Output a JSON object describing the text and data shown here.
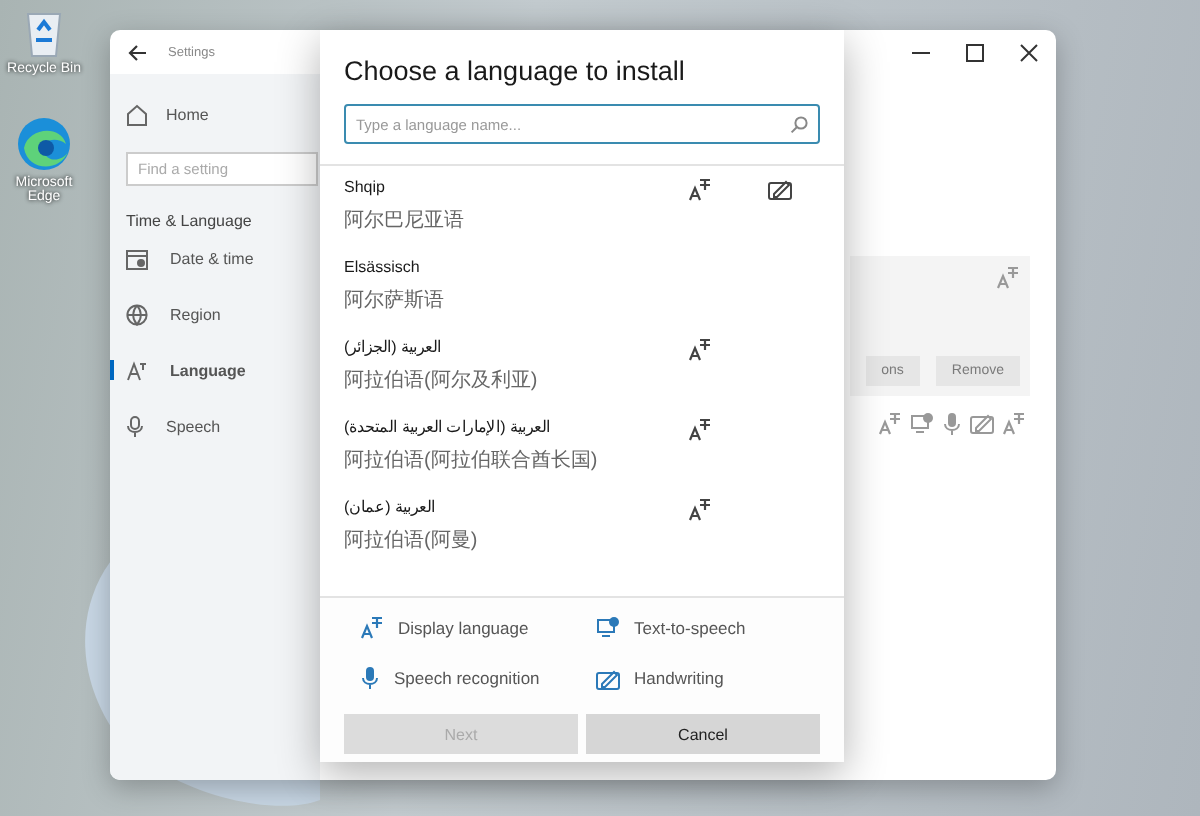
{
  "desktop_icons": [
    {
      "label": "Recycle Bin",
      "kind": "recycle-bin"
    },
    {
      "label": "Microsoft Edge",
      "kind": "browser"
    }
  ],
  "settings": {
    "title": "Settings",
    "home": "Home",
    "search": {
      "placeholder": "Find a setting"
    },
    "section": "Time & Language",
    "nav": [
      {
        "label": "Date & time",
        "kind": "calendar",
        "selected": false
      },
      {
        "label": "Region",
        "kind": "globe",
        "selected": false
      },
      {
        "label": "Language",
        "kind": "language",
        "selected": true
      },
      {
        "label": "Speech",
        "kind": "mic",
        "selected": false
      }
    ],
    "content_buttons": [
      {
        "label": "ons"
      },
      {
        "label": "Remove"
      }
    ]
  },
  "dialog": {
    "title": "Choose a language to install",
    "search": {
      "placeholder": "Type a language name..."
    },
    "languages": [
      {
        "name": "Shqip",
        "native": "阿尔巴尼亚语",
        "display_language": true,
        "handwriting": true
      },
      {
        "name": "Elsässisch",
        "native": "阿尔萨斯语",
        "display_language": false,
        "handwriting": false
      },
      {
        "name": "العربية (الجزائر)",
        "native": "阿拉伯语(阿尔及利亚)",
        "display_language": true,
        "handwriting": false
      },
      {
        "name": "العربية (الإمارات العربية المتحدة)",
        "native": "阿拉伯语(阿拉伯联合酋长国)",
        "display_language": true,
        "handwriting": false
      },
      {
        "name": "العربية (عمان)",
        "native": "阿拉伯语(阿曼)",
        "display_language": true,
        "handwriting": false
      }
    ],
    "legend": [
      {
        "label": "Display language",
        "kind": "display"
      },
      {
        "label": "Text-to-speech",
        "kind": "tts"
      },
      {
        "label": "Speech recognition",
        "kind": "speech"
      },
      {
        "label": "Handwriting",
        "kind": "handwriting"
      }
    ],
    "buttons": [
      {
        "label": "Next",
        "disabled": true
      },
      {
        "label": "Cancel",
        "disabled": false
      }
    ]
  }
}
